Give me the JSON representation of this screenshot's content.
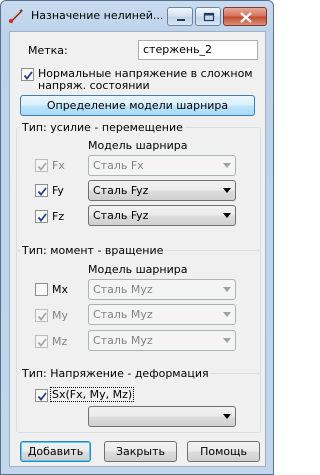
{
  "window": {
    "title": "Назначение нелиней...",
    "minimize_label": "minimize",
    "maximize_label": "maximize",
    "close_label": "close"
  },
  "label_row": {
    "label": "Метка:",
    "value": "стержень_2"
  },
  "normal_stress": {
    "line1": "Нормальные напряжение в сложном",
    "line2": "напряж. состоянии",
    "checked": true
  },
  "define_hinge_button": "Определение модели шарнира",
  "group_force": {
    "title": "Тип: усилие - перемещение",
    "subheader": "Модель шарнира",
    "rows": [
      {
        "label": "Fx",
        "checked": true,
        "enabled": false,
        "model": "Сталь Fx"
      },
      {
        "label": "Fy",
        "checked": true,
        "enabled": true,
        "model": "Сталь Fyz"
      },
      {
        "label": "Fz",
        "checked": true,
        "enabled": true,
        "model": "Сталь Fyz"
      }
    ]
  },
  "group_moment": {
    "title": "Тип: момент - вращение",
    "subheader": "Модель шарнира",
    "rows": [
      {
        "label": "Mx",
        "checked": false,
        "enabled": true,
        "model": "Сталь Myz"
      },
      {
        "label": "My",
        "checked": true,
        "enabled": false,
        "model": "Сталь Myz"
      },
      {
        "label": "Mz",
        "checked": true,
        "enabled": false,
        "model": "Сталь Myz"
      }
    ]
  },
  "group_stress": {
    "title": "Тип: Напряжение - деформация",
    "checkbox_label": "Sx(Fx, My, Mz)",
    "checked": true,
    "model": ""
  },
  "buttons": {
    "add": "Добавить",
    "close": "Закрыть",
    "help": "Помощь"
  }
}
